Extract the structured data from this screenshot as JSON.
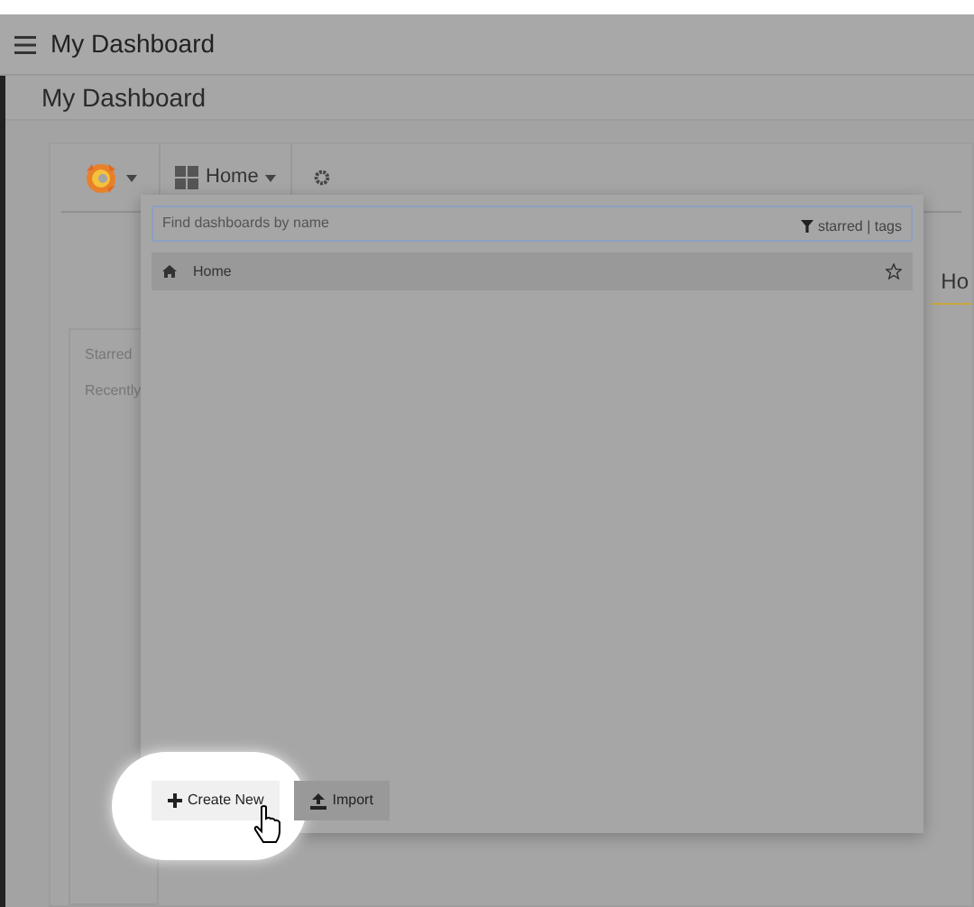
{
  "app_bar": {
    "title": "My Dashboard"
  },
  "page_header": {
    "title": "My Dashboard"
  },
  "toolbar": {
    "dashboard_button": "Home"
  },
  "background_panel": {
    "items": [
      "Starred",
      "Recently"
    ],
    "tab": "Ho"
  },
  "dashboard_search": {
    "placeholder": "Find dashboards by name",
    "filter": "starred | tags",
    "results": [
      {
        "title": "Home",
        "starred": false
      }
    ],
    "buttons": [
      {
        "label": "Create New",
        "kind": "create",
        "highlighted": true
      },
      {
        "label": "Import",
        "kind": "import",
        "highlighted": false
      }
    ]
  }
}
